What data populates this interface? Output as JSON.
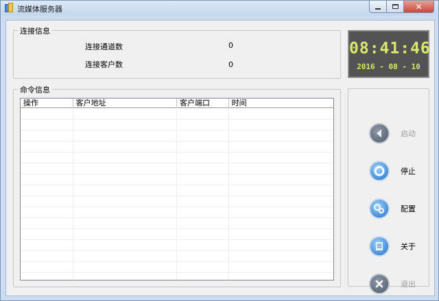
{
  "window": {
    "title": "流媒体服务器"
  },
  "connection": {
    "group_title": "连接信息",
    "channel_count_label": "连接通道数",
    "channel_count_value": "0",
    "client_count_label": "连接客户数",
    "client_count_value": "0"
  },
  "command": {
    "group_title": "命令信息",
    "columns": [
      "操作",
      "客户地址",
      "客户端口",
      "时间"
    ]
  },
  "clock": {
    "time": "08:41:46",
    "date": "2016 - 08 - 10",
    "color": "#d8e86a"
  },
  "actions": {
    "start": {
      "label": "启动",
      "enabled": false,
      "icon": "play-icon"
    },
    "stop": {
      "label": "停止",
      "enabled": true,
      "icon": "stop-icon"
    },
    "config": {
      "label": "配置",
      "enabled": true,
      "icon": "gears-icon"
    },
    "about": {
      "label": "关于",
      "enabled": true,
      "icon": "document-icon"
    },
    "exit": {
      "label": "退出",
      "enabled": false,
      "icon": "close-icon"
    }
  }
}
